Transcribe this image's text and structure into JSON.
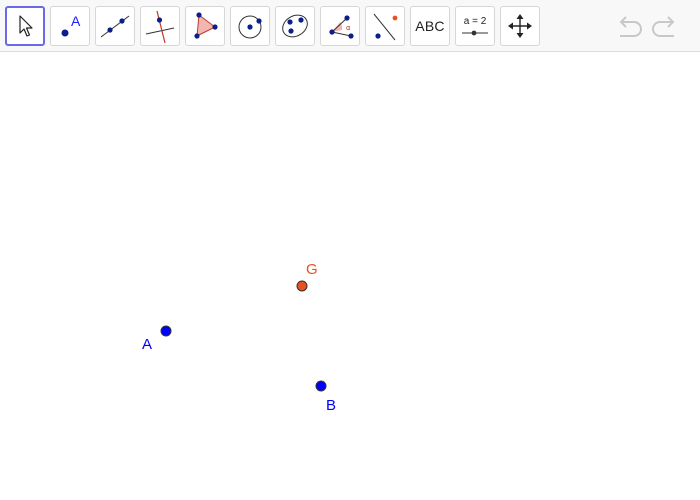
{
  "toolbar": {
    "tools": [
      {
        "name": "move-tool",
        "selected": true
      },
      {
        "name": "point-tool",
        "text": "A"
      },
      {
        "name": "line-tool"
      },
      {
        "name": "perpendicular-line-tool"
      },
      {
        "name": "polygon-tool"
      },
      {
        "name": "circle-center-point-tool"
      },
      {
        "name": "conic-ellipse-tool"
      },
      {
        "name": "angle-tool",
        "text": "α"
      },
      {
        "name": "reflect-tool"
      },
      {
        "name": "text-tool",
        "text": "ABC"
      },
      {
        "name": "slider-tool",
        "text": "a = 2"
      },
      {
        "name": "move-graphics-view-tool"
      }
    ],
    "undo_icon": "undo-icon",
    "redo_icon": "redo-icon"
  },
  "points": {
    "A": {
      "label": "A",
      "color": "#0000ff"
    },
    "B": {
      "label": "B",
      "color": "#0000ff"
    },
    "G": {
      "label": "G",
      "color": "#e8501e"
    }
  },
  "colors": {
    "accent": "#6a6ae8",
    "point_blue": "#0000ff",
    "point_orange": "#e8501e",
    "icon_point": "#0a1f8c",
    "polygon_fill": "#f2b6b0"
  }
}
